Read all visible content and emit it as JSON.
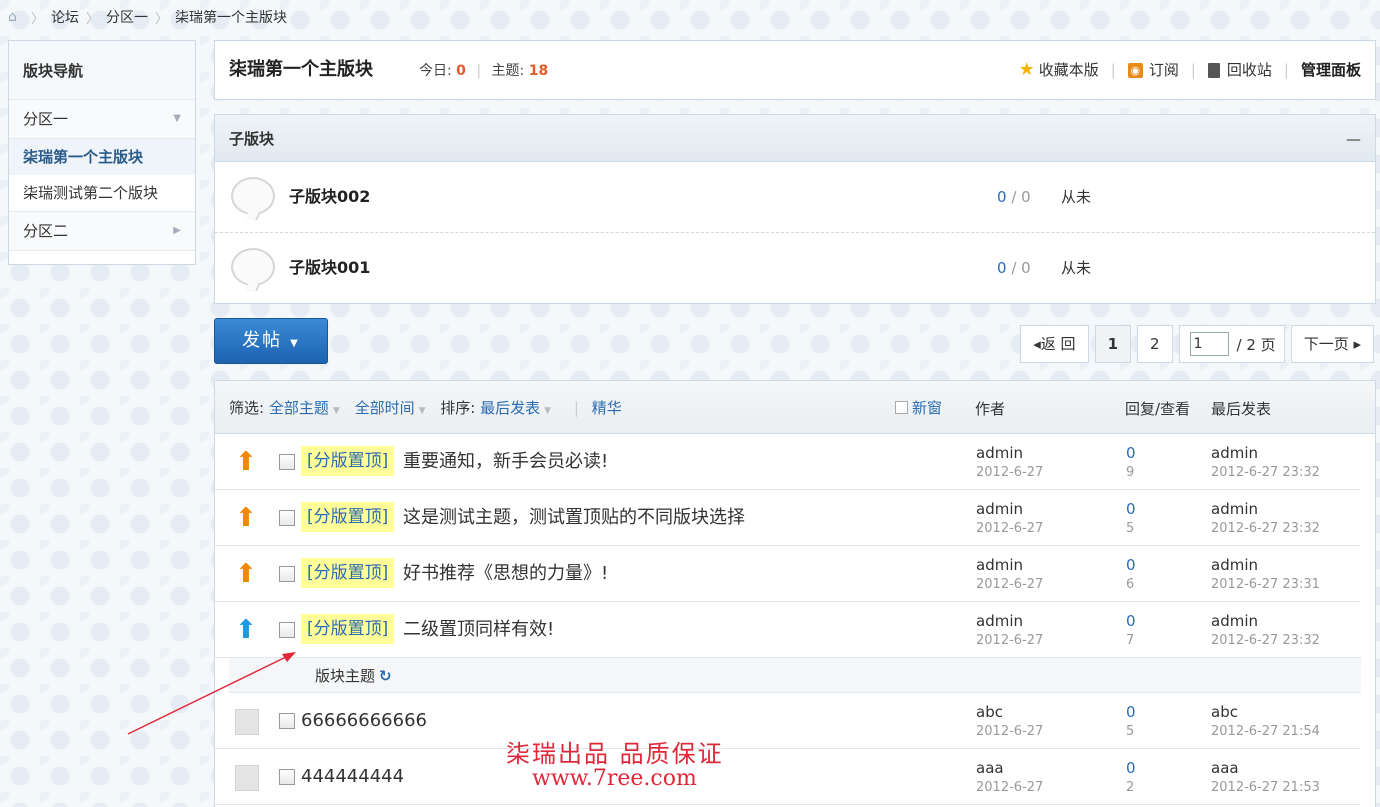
{
  "breadcrumb": {
    "items": [
      "论坛",
      "分区一",
      "柒瑞第一个主版块"
    ]
  },
  "sidebar": {
    "title": "版块导航",
    "group1": "分区一",
    "items": [
      "柒瑞第一个主版块",
      "柒瑞测试第二个版块"
    ],
    "group2": "分区二"
  },
  "forum": {
    "name": "柒瑞第一个主版块",
    "today_label": "今日:",
    "today_value": "0",
    "topics_label": "主题:",
    "topics_value": "18",
    "actions": {
      "favorite": "收藏本版",
      "subscribe": "订阅",
      "recycle": "回收站",
      "manage": "管理面板"
    }
  },
  "subforums": {
    "title": "子版块",
    "collapse": "—",
    "rows": [
      {
        "name": "子版块002",
        "threads": "0",
        "posts": "0",
        "last": "从未"
      },
      {
        "name": "子版块001",
        "threads": "0",
        "posts": "0",
        "last": "从未"
      }
    ]
  },
  "post_button": "发帖",
  "pager": {
    "back": "◂返 回",
    "page1": "1",
    "page2": "2",
    "input_value": "1",
    "total": "/ 2 页",
    "next": "下一页 ▸"
  },
  "thread_header": {
    "filter_label": "筛选:",
    "filter_all": "全部主题",
    "filter_time": "全部时间",
    "sort_label": "排序:",
    "sort_value": "最后发表",
    "digest": "精华",
    "new_window": "新窗",
    "col_author": "作者",
    "col_reply": "回复/查看",
    "col_last": "最后发表"
  },
  "sticky_threads": [
    {
      "tag": "[分版置顶]",
      "title": "重要通知，新手会员必读!",
      "author": "admin",
      "date": "2012-6-27",
      "replies": "0",
      "views": "9",
      "last_user": "admin",
      "last_time": "2012-6-27 23:32"
    },
    {
      "tag": "[分版置顶]",
      "title": "这是测试主题，测试置顶贴的不同版块选择",
      "author": "admin",
      "date": "2012-6-27",
      "replies": "0",
      "views": "5",
      "last_user": "admin",
      "last_time": "2012-6-27 23:32"
    },
    {
      "tag": "[分版置顶]",
      "title": "好书推荐《思想的力量》!",
      "author": "admin",
      "date": "2012-6-27",
      "replies": "0",
      "views": "6",
      "last_user": "admin",
      "last_time": "2012-6-27 23:31"
    },
    {
      "tag": "[分版置顶]",
      "title": "二级置顶同样有效!",
      "author": "admin",
      "date": "2012-6-27",
      "replies": "0",
      "views": "7",
      "last_user": "admin",
      "last_time": "2012-6-27 23:32"
    }
  ],
  "section_label": "版块主题",
  "normal_threads": [
    {
      "title": "66666666666",
      "author": "abc",
      "date": "2012-6-27",
      "replies": "0",
      "views": "5",
      "last_user": "abc",
      "last_time": "2012-6-27 21:54"
    },
    {
      "title": "444444444",
      "author": "aaa",
      "date": "2012-6-27",
      "replies": "0",
      "views": "2",
      "last_user": "aaa",
      "last_time": "2012-6-27 21:53"
    }
  ],
  "watermark": {
    "line1": "柒瑞出品  品质保证",
    "line2": "www.7ree.com"
  },
  "colors": {
    "accent": "#2b6cb0",
    "highlight": "#e05c2c",
    "sticky_tag_bg": "#fffe99",
    "watermark": "#e0283a"
  }
}
